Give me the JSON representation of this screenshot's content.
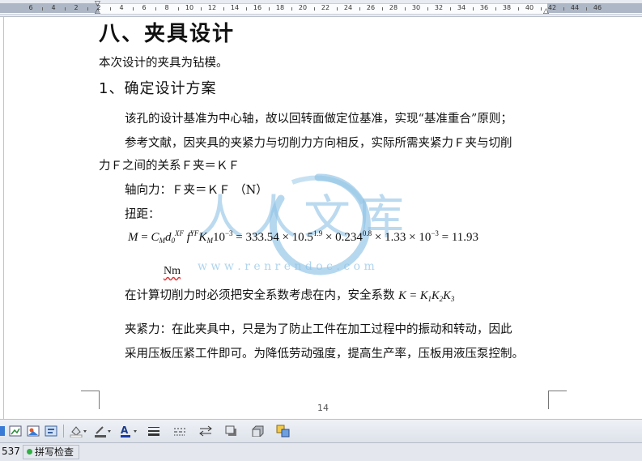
{
  "ruler": {
    "labels": [
      "6",
      "4",
      "2",
      "2",
      "4",
      "6",
      "8",
      "10",
      "12",
      "14",
      "16",
      "18",
      "20",
      "22",
      "24",
      "26",
      "28",
      "30",
      "32",
      "34",
      "36",
      "38",
      "40",
      "42",
      "44",
      "46"
    ]
  },
  "document": {
    "heading": "八、夹具设计",
    "intro": "本次设计的夹具为钻模。",
    "section_title": "1、确定设计方案",
    "para1": "该孔的设计基准为中心轴，故以回转面做定位基准，实现“基准重合”原则；",
    "para2_line1": "参考文献，因夹具的夹紧力与切削力方向相反，实际所需夹紧力Ｆ夹与切削",
    "para2_line2": "力Ｆ之间的关系Ｆ夹＝ＫＦ",
    "axial_force": "轴向力：Ｆ夹＝ＫＦ （N）",
    "torque_label": "扭距：",
    "formula": {
      "lhs": "M",
      "eq1": "=",
      "C": "C",
      "C_sub": "M",
      "d": "d",
      "d_sub": "0",
      "d_sup": "XF",
      "f": "f",
      "f_sup": "YF",
      "K": "K",
      "K_sub": "M",
      "pow": "10",
      "pow_sup": "−3",
      "rhs": "= 333.54 × 10.5",
      "rhs_sup1": "1.9",
      "rhs2": " × 0.234",
      "rhs_sup2": "0.8",
      "rhs3": " × 1.33 × 10",
      "rhs_sup3": "−3",
      "rhs4": " = 11.93"
    },
    "unit": "Nm",
    "safety_text": "在计算切削力时必须把安全系数考虑在内，安全系数",
    "safety_formula": "K = K",
    "safety_sub1": "1",
    "safety_k2": "K",
    "safety_sub2": "2",
    "safety_k3": "K",
    "safety_sub3": "3",
    "clamp_line1": "夹紧力：在此夹具中，只是为了防止工件在加工过程中的振动和转动，因此",
    "clamp_line2": "采用压板压紧工件即可。为降低劳动强度，提高生产率，压板用液压泵控制。",
    "page_number": "14"
  },
  "watermark": {
    "text": "人人文库",
    "url_text": "w w w . r e n r e n d o c . c o m"
  },
  "colors": {
    "watermark": "#8fc3e6",
    "ruler_margin": "#aeb7c5",
    "spell_ok": "#31b043"
  },
  "toolbar": {
    "icons": [
      "picture-icon",
      "chart-icon",
      "clipart-icon",
      "textbox-icon",
      "fill-color-icon",
      "line-color-icon",
      "font-color-icon",
      "line-style-icon",
      "dash-style-icon",
      "arrow-style-icon",
      "shadow-icon",
      "3d-icon",
      "select-objects-icon"
    ]
  },
  "status": {
    "count": "537",
    "spell_check": "拼写检查"
  }
}
